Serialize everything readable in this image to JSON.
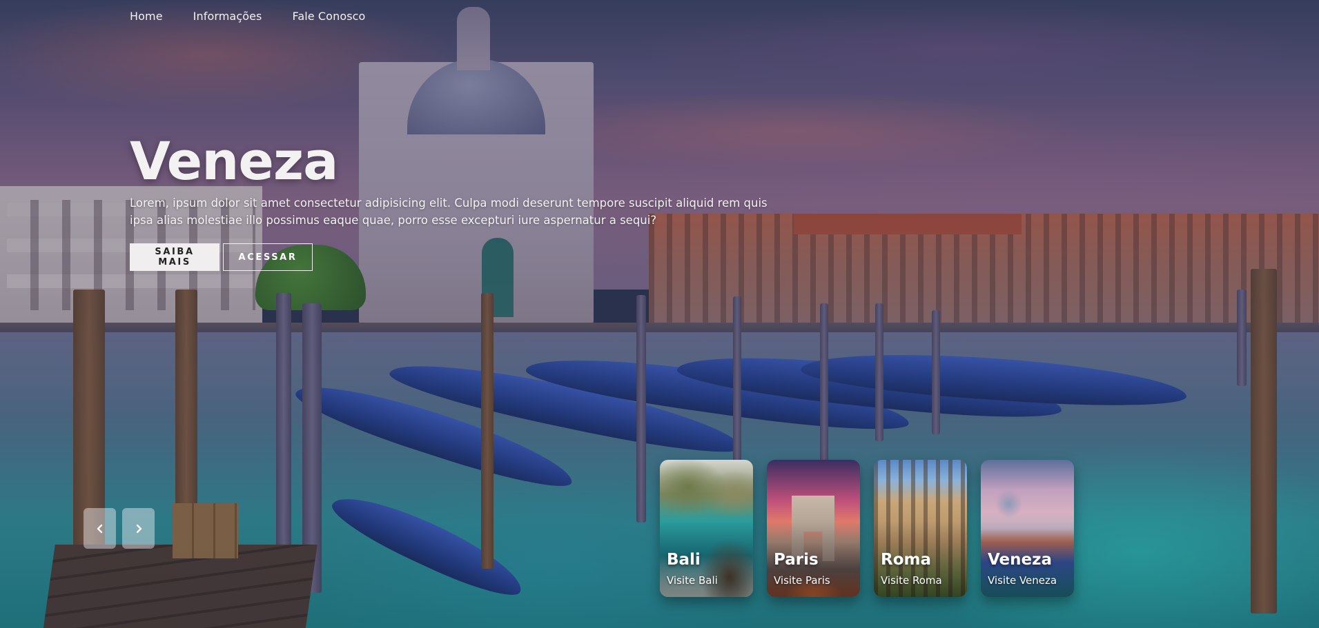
{
  "nav": {
    "items": [
      "Home",
      "Informações",
      "Fale Conosco"
    ]
  },
  "hero": {
    "title": "Veneza",
    "description": "Lorem, ipsum dolor sit amet consectetur adipisicing elit. Culpa modi deserunt tempore suscipit aliquid rem quis ipsa alias molestiae illo possimus eaque quae, porro esse excepturi iure aspernatur a sequi?",
    "buttons": {
      "primary": "SAIBA MAIS",
      "secondary": "ACESSAR"
    }
  },
  "carousel": {
    "prev_icon": "chevron-left-icon",
    "next_icon": "chevron-right-icon",
    "cards": [
      {
        "name": "Bali",
        "desc": "Visite Bali"
      },
      {
        "name": "Paris",
        "desc": "Visite Paris"
      },
      {
        "name": "Roma",
        "desc": "Visite Roma"
      },
      {
        "name": "Veneza",
        "desc": "Visite Veneza"
      }
    ]
  },
  "colors": {
    "button_bg": "#f0eeef",
    "button_text": "#222222",
    "text": "#ffffff"
  }
}
